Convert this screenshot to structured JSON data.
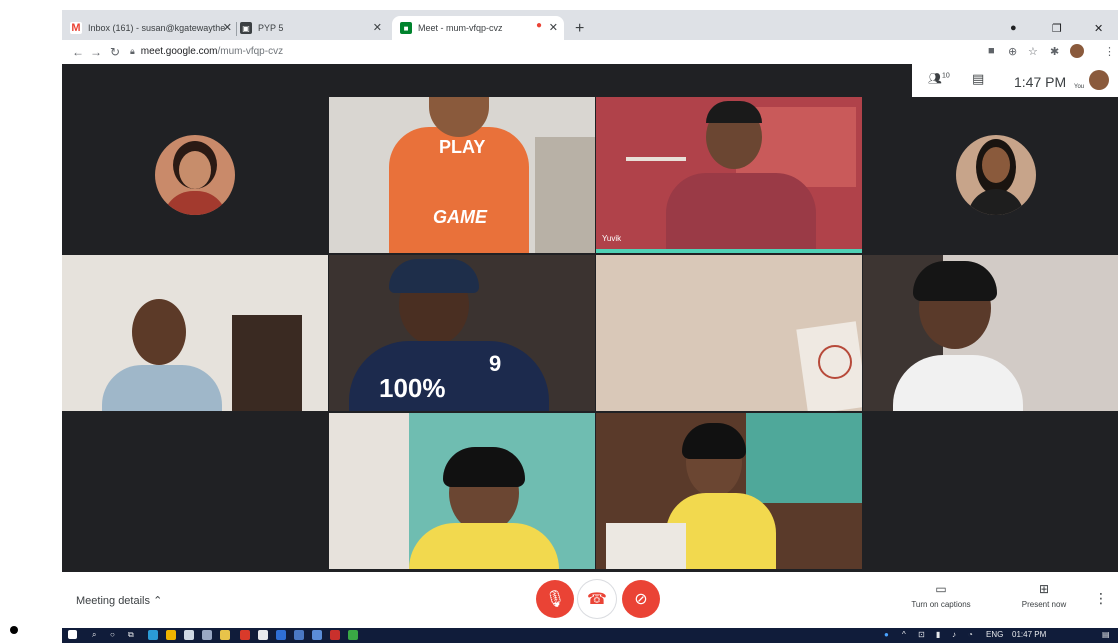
{
  "browser": {
    "tabs": [
      {
        "label": "Inbox (161) - susan@kgatewaythe",
        "icon": "gmail-icon"
      },
      {
        "label": "PYP 5",
        "icon": "classroom-icon"
      },
      {
        "label": "Meet - mum-vfqp-cvz",
        "icon": "meet-icon",
        "active": true
      }
    ],
    "new_tab": "+",
    "url_host": "meet.google.com",
    "url_path": "/mum-vfqp-cvz"
  },
  "meet": {
    "participants_count": "10",
    "clock": "1:47 PM",
    "self_label": "You",
    "active_speaker_name": "Yuvik",
    "meeting_details": "Meeting details",
    "caption_label": "Turn on captions",
    "present_label": "Present now"
  },
  "taskbar": {
    "lang": "ENG",
    "clock": "01:47 PM"
  },
  "colors": {
    "meet_bg": "#202124",
    "danger": "#ea4335",
    "active_border": "#4fd1b5"
  }
}
